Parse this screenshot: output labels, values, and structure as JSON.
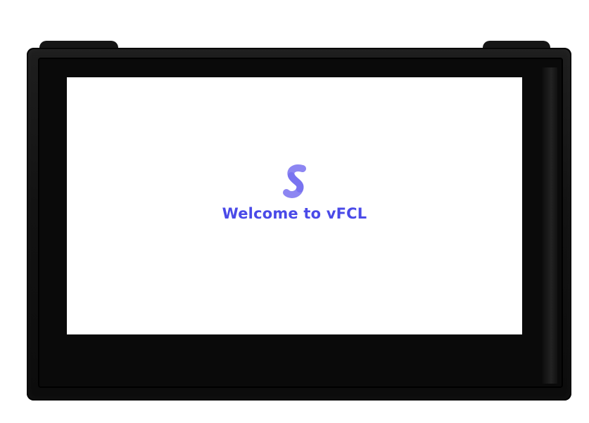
{
  "colors": {
    "accent": "#4a4ae8",
    "logo_light": "#8d86f2",
    "logo_dark": "#6a64ee",
    "bezel": "#0a0a0a",
    "screen_background": "#ffffff"
  },
  "screen": {
    "logo_icon": "vfcl-logo-icon",
    "welcome_text": "Welcome to vFCL"
  }
}
